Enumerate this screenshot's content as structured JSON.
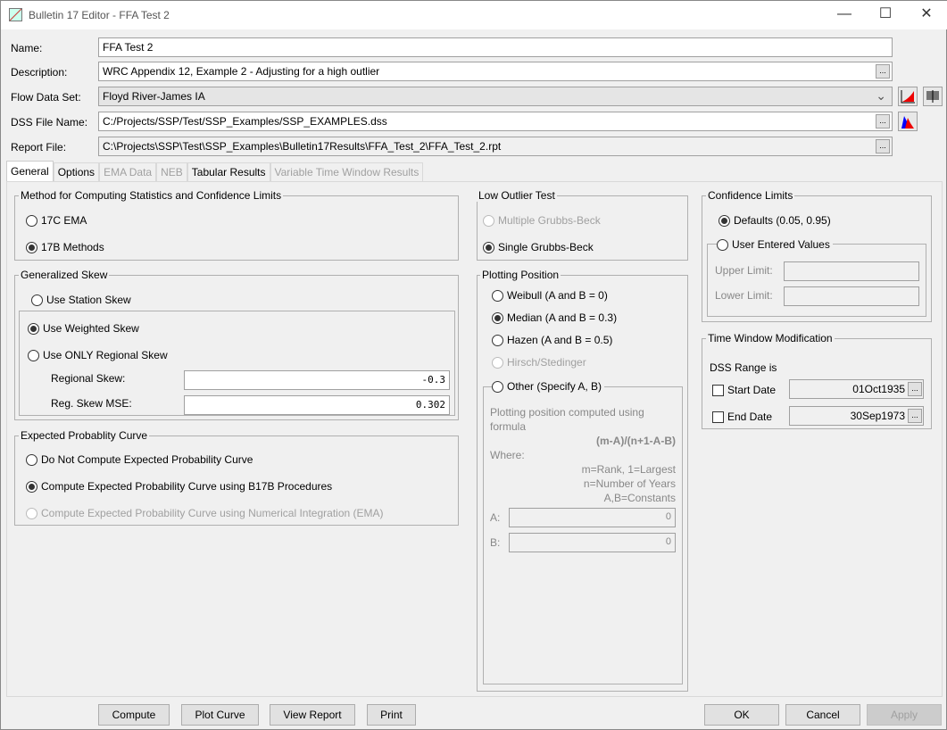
{
  "window": {
    "title": "Bulletin 17 Editor - FFA Test 2",
    "minimize": "—",
    "maximize": "☐",
    "close": "✕"
  },
  "form": {
    "name_label": "Name:",
    "name_value": "FFA Test 2",
    "description_label": "Description:",
    "description_value": "WRC Appendix 12, Example 2 - Adjusting for a high outlier",
    "flow_label": "Flow Data Set:",
    "flow_value": "Floyd River-James IA",
    "dss_label": "DSS File Name:",
    "dss_value": "C:/Projects/SSP/Test/SSP_Examples/SSP_EXAMPLES.dss",
    "report_label": "Report File:",
    "report_value": "C:\\Projects\\SSP\\Test\\SSP_Examples\\Bulletin17Results\\FFA_Test_2\\FFA_Test_2.rpt",
    "browse": "...",
    "dropdown_arrow": "⌄"
  },
  "tabs": [
    {
      "label": "General"
    },
    {
      "label": "Options"
    },
    {
      "label": "EMA Data"
    },
    {
      "label": "NEB"
    },
    {
      "label": "Tabular Results"
    },
    {
      "label": "Variable Time Window Results"
    }
  ],
  "method": {
    "title": "Method for Computing Statistics and Confidence Limits",
    "opt1": "17C EMA",
    "opt2": "17B Methods"
  },
  "skew": {
    "title": "Generalized Skew",
    "station": "Use Station Skew",
    "weighted": "Use Weighted Skew",
    "regional_only": "Use ONLY Regional Skew",
    "regional_label": "Regional Skew:",
    "regional_value": "-0.3",
    "mse_label": "Reg. Skew MSE:",
    "mse_value": "0.302"
  },
  "expected": {
    "title": "Expected Probablity Curve",
    "opt1": "Do Not Compute Expected Probability Curve",
    "opt2": "Compute Expected Probability Curve using B17B Procedures",
    "opt3": "Compute Expected Probability Curve using Numerical Integration (EMA)"
  },
  "low_outlier": {
    "title": "Low Outlier Test",
    "opt1": "Multiple Grubbs-Beck",
    "opt2": "Single Grubbs-Beck"
  },
  "plotting": {
    "title": "Plotting Position",
    "weibull": "Weibull (A and B = 0)",
    "median": "Median (A and B = 0.3)",
    "hazen": "Hazen (A and B = 0.5)",
    "hirsch": "Hirsch/Stedinger",
    "other": "Other (Specify A, B)",
    "desc1": "Plotting position computed using",
    "desc2": "formula",
    "formula": "(m-A)/(n+1-A-B)",
    "where": "Where:",
    "w1": "m=Rank, 1=Largest",
    "w2": "n=Number of Years",
    "w3": "A,B=Constants",
    "a_label": "A:",
    "a_value": "0",
    "b_label": "B:",
    "b_value": "0"
  },
  "confidence": {
    "title": "Confidence Limits",
    "defaults": "Defaults (0.05, 0.95)",
    "user": "User Entered Values",
    "upper_label": "Upper Limit:",
    "lower_label": "Lower Limit:"
  },
  "time_window": {
    "title": "Time Window Modification",
    "range_label": "DSS Range is",
    "start_label": "Start Date",
    "start_value": "01Oct1935",
    "end_label": "End Date",
    "end_value": "30Sep1973"
  },
  "buttons": {
    "compute": "Compute",
    "plot": "Plot Curve",
    "view_report": "View Report",
    "print": "Print",
    "ok": "OK",
    "cancel": "Cancel",
    "apply": "Apply"
  }
}
